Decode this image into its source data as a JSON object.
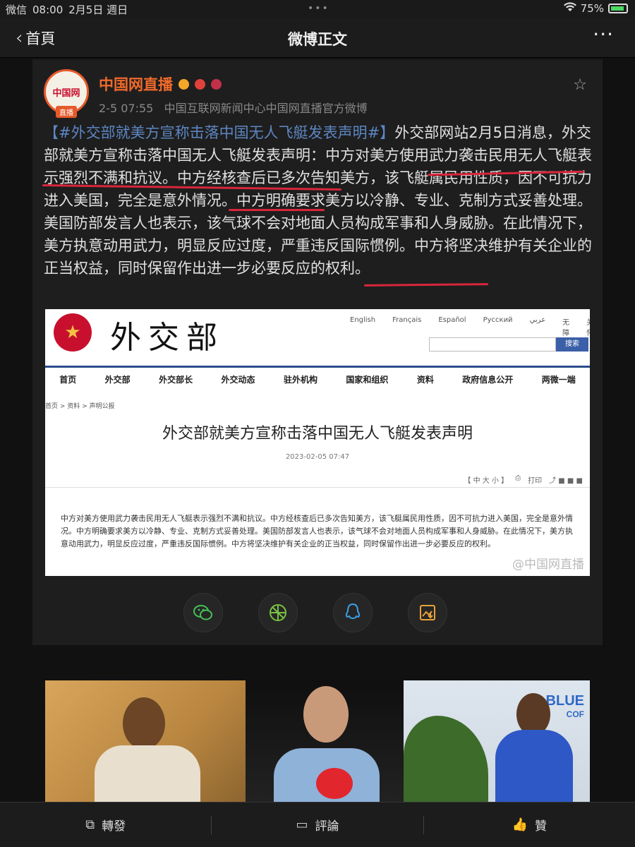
{
  "status_bar": {
    "carrier": "微信",
    "time": "08:00",
    "date": "2月5日 週日",
    "battery": "75%"
  },
  "nav": {
    "back_label": "首頁",
    "title": "微博正文"
  },
  "post": {
    "author": "中国网直播",
    "avatar_text": "中国网",
    "avatar_badge": "直播",
    "time": "2-5 07:55",
    "source": "中国互联网新闻中心中国网直播官方微博",
    "hashtag": "【#外交部就美方宣称击落中国无人飞艇发表声明#】",
    "text": "外交部网站2月5日消息，外交部就美方宣称击落中国无人飞艇发表声明：中方对美方使用武力袭击民用无人飞艇表示强烈不满和抗议。中方经核查后已多次告知美方，该飞艇属民用性质，因不可抗力进入美国，完全是意外情况。中方明确要求美方以冷静、专业、克制方式妥善处理。美国防部发言人也表示，该气球不会对地面人员构成军事和人身威胁。在此情况下，美方执意动用武力，明显反应过度，严重违反国际惯例。中方将坚决维护有关企业的正当权益，同时保留作出进一步必要反应的权利。"
  },
  "embed": {
    "site_name": "外交部",
    "languages": [
      "English",
      "Français",
      "Español",
      "Русский",
      "عربي",
      "无障碍",
      "关怀"
    ],
    "search_button": "搜索",
    "nav_items": [
      "首页",
      "外交部",
      "外交部长",
      "外交动态",
      "驻外机构",
      "国家和组织",
      "资料",
      "政府信息公开",
      "两微一端"
    ],
    "breadcrumb": "首页 > 资料 > 声明公报",
    "title": "外交部就美方宣称击落中国无人飞艇发表声明",
    "date": "2023-02-05 07:47",
    "font_size_controls": "【 中 大 小 】",
    "print_label": "打印",
    "body": "中方对美方使用武力袭击民用无人飞艇表示强烈不满和抗议。中方经核查后已多次告知美方，该飞艇属民用性质，因不可抗力进入美国，完全是意外情况。中方明确要求美方以冷静、专业、克制方式妥善处理。美国防部发言人也表示，该气球不会对地面人员构成军事和人身威胁。在此情况下，美方执意动用武力，明显反应过度，严重违反国际惯例。中方将坚决维护有关企业的正当权益，同时保留作出进一步必要反应的权利。",
    "watermark": "@中国网直播"
  },
  "recs": {
    "rec3_sign": "BLUE",
    "rec3_sign_sub": "COF"
  },
  "toolbar": {
    "repost": "轉發",
    "comment": "評論",
    "like": "贊"
  },
  "colors": {
    "author_orange": "#f06a2b",
    "hashtag_blue": "#5d86c2",
    "underline_red": "#d8263c",
    "background": "#111111"
  },
  "icons": [
    "chevron-left-icon",
    "more-icon",
    "star-icon",
    "wechat-icon",
    "moments-icon",
    "qq-icon",
    "save-image-icon",
    "repost-icon",
    "comment-icon",
    "like-icon",
    "wifi-icon",
    "battery-icon"
  ]
}
